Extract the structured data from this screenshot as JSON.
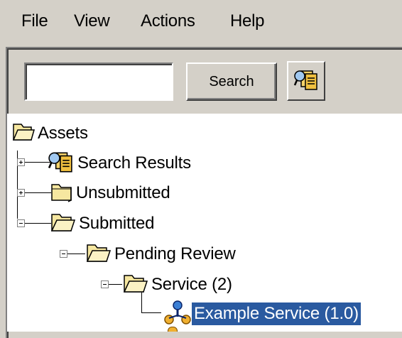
{
  "menu": {
    "file": "File",
    "view": "View",
    "actions": "Actions",
    "help": "Help"
  },
  "search": {
    "value": "",
    "button_label": "Search",
    "results_icon": "search-results-icon"
  },
  "tree": {
    "root": {
      "label": "Assets",
      "icon": "folder-open-icon"
    },
    "items": [
      {
        "label": "Search Results",
        "icon": "search-results-icon",
        "expanded": false
      },
      {
        "label": "Unsubmitted",
        "icon": "folder-closed-icon",
        "expanded": false
      },
      {
        "label": "Submitted",
        "icon": "folder-open-icon",
        "expanded": true
      },
      {
        "label": "Pending Review",
        "icon": "folder-open-icon",
        "expanded": true
      },
      {
        "label": "Service (2)",
        "icon": "folder-open-icon",
        "expanded": true
      },
      {
        "label": "Example Service (1.0)",
        "icon": "service-icon",
        "selected": true
      }
    ]
  },
  "colors": {
    "window_bg": "#d4d0c8",
    "selection_bg": "#0a246a",
    "folder_yellow": "#f6e7a0"
  }
}
